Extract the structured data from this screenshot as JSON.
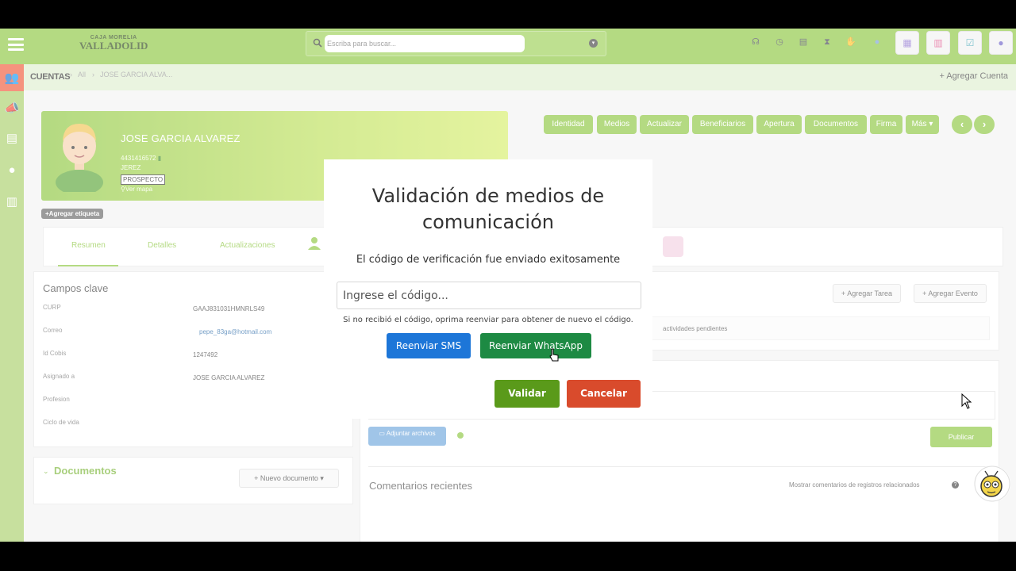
{
  "app": {
    "logo_line1": "CAJA MORELIA",
    "logo_line2": "VALLADOLID",
    "search_placeholder": "Escriba para buscar...",
    "colors": {
      "brand": "#8cc63f",
      "accent_red": "#f05a3a",
      "blue": "#1d76d8",
      "whatsapp": "#1d8a43",
      "cancel": "#d94b2c"
    }
  },
  "topbar": {
    "icons": [
      "headset-icon",
      "clock-icon",
      "inbox-icon",
      "hourglass-icon",
      "hand-icon",
      "gear-icon"
    ],
    "square_icons": [
      "calendar-icon",
      "chart-icon",
      "tasks-icon",
      "user-icon"
    ]
  },
  "breadcrumb": {
    "title": "CUENTAS",
    "all": "All",
    "current": "JOSE GARCIA ALVA...",
    "add_label": "Agregar Cuenta"
  },
  "sidebar": {
    "items": [
      "accounts-icon",
      "megaphone-icon",
      "id-card-icon",
      "person-icon",
      "building-icon"
    ]
  },
  "profile": {
    "name": "JOSE GARCIA ALVAREZ",
    "phone": "4431416572",
    "location": "JEREZ",
    "status": "PROSPECTO",
    "map_link": "Ver mapa",
    "add_tag": "Agregar etiqueta"
  },
  "actions": {
    "buttons": [
      "Identidad",
      "Medios",
      "Actualizar",
      "Beneficiarios",
      "Apertura",
      "Documentos",
      "Firma",
      "Más"
    ]
  },
  "tabs": [
    "Resumen",
    "Detalles",
    "Actualizaciones"
  ],
  "campos": {
    "title": "Campos clave",
    "fields": [
      {
        "label": "CURP",
        "value": "GAAJ831031HMNRLS49"
      },
      {
        "label": "Correo",
        "value": "pepe_83ga@hotmail.com"
      },
      {
        "label": "Id Cobis",
        "value": "1247492"
      },
      {
        "label": "Asignado a",
        "value": "JOSE GARCIA ALVAREZ"
      },
      {
        "label": "Profesion",
        "value": ""
      },
      {
        "label": "Ciclo de vida",
        "value": ""
      }
    ]
  },
  "documentos": {
    "title": "Documentos",
    "new_button": "Nuevo documento"
  },
  "tasks": {
    "add_task": "Agregar Tarea",
    "add_event": "Agregar Evento",
    "pending_text": "actividades pendientes"
  },
  "comments": {
    "attach": "Adjuntar archivos",
    "publish": "Publicar",
    "recent_title": "Comentarios recientes",
    "show_related": "Mostrar comentarios de registros relacionados"
  },
  "modal": {
    "title_line1": "Validación de medios de",
    "title_line2": "comunicación",
    "subtitle": "El código de verificación fue enviado exitosamente",
    "code_placeholder": "Ingrese el código...",
    "hint": "Si no recibió el código, oprima reenviar para obtener de nuevo el código.",
    "resend_sms": "Reenviar SMS",
    "resend_whatsapp": "Reenviar WhatsApp",
    "validate": "Validar",
    "cancel": "Cancelar"
  }
}
